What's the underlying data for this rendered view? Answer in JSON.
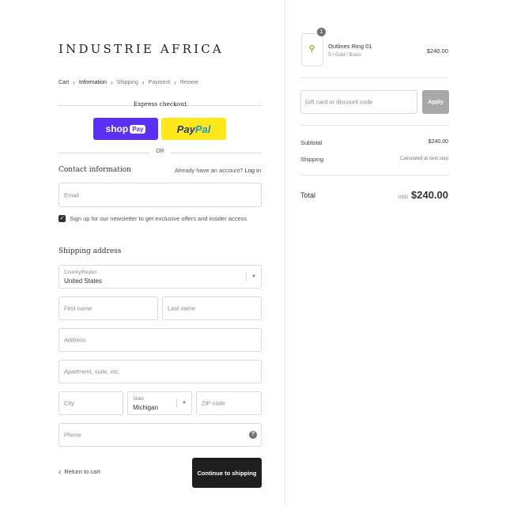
{
  "brand": {
    "logo": "INDUSTRIE AFRICA"
  },
  "breadcrumb": {
    "items": [
      {
        "label": "Cart"
      },
      {
        "label": "Information"
      },
      {
        "label": "Shipping"
      },
      {
        "label": "Payment"
      },
      {
        "label": "Review"
      }
    ],
    "active": "Information"
  },
  "express": {
    "title": "Express checkout",
    "shoppay": {
      "word": "shop",
      "box": "Pay",
      "color": "#5a31f4"
    },
    "paypal": {
      "part1": "Pay",
      "part2": "Pal",
      "color": "#ffe81a"
    },
    "or_label": "OR"
  },
  "contact": {
    "title": "Contact information",
    "login_prompt": "Already have an account?",
    "login_link": "Log in",
    "email_placeholder": "Email",
    "newsletter_checked": true,
    "newsletter_label": "Sign up for our newsletter to get exclusive offers and insider access"
  },
  "shipping": {
    "title": "Shipping address",
    "country_label": "Country/Region",
    "country_value": "United States",
    "first_name_placeholder": "First name",
    "last_name_placeholder": "Last name",
    "address_placeholder": "Address",
    "apartment_placeholder": "Apartment, suite, etc.",
    "city_placeholder": "City",
    "state_label": "State",
    "state_value": "Michigan",
    "zip_placeholder": "ZIP code",
    "phone_placeholder": "Phone"
  },
  "footer": {
    "return_label": "Return to cart",
    "continue_label": "Continue to shipping"
  },
  "summary": {
    "item": {
      "quantity": "1",
      "name": "Outlines Ring 01",
      "variant": "S / Gold / Brass",
      "price": "$240.00"
    },
    "discount_placeholder": "Gift card or discount code",
    "apply_label": "Apply",
    "subtotal_label": "Subtotal",
    "subtotal_value": "$240.00",
    "shipping_label": "Shipping",
    "shipping_value": "Calculated at next step",
    "total_label": "Total",
    "total_currency": "USD",
    "total_value": "$240.00"
  }
}
